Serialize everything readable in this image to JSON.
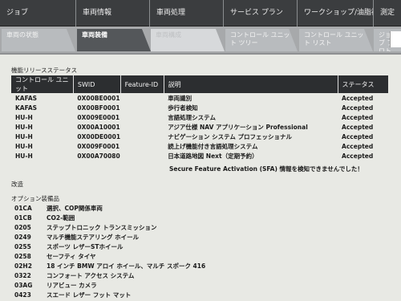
{
  "top_nav": {
    "items": [
      "ジョブ",
      "車両情報",
      "車両処理",
      "サービス プラン",
      "ワークショップ/油脂補",
      "測定"
    ]
  },
  "sub_tabs": [
    {
      "label": "車両の状態"
    },
    {
      "label": "車両装備"
    },
    {
      "label": "車両構成"
    },
    {
      "label": "コントロール ユニット ツリー"
    },
    {
      "label": "コントロール ユニット リスト"
    },
    {
      "label": "ジョブ プロトコル"
    }
  ],
  "release_status": {
    "title": "機能リリースステータス",
    "headers": [
      "コントロール ユニット",
      "SWID",
      "Feature-ID",
      "説明",
      "ステータス"
    ],
    "rows": [
      {
        "unit": "KAFAS",
        "swid": "0X00BE0001",
        "feature": "",
        "desc": "車両識別",
        "status": "Accepted"
      },
      {
        "unit": "KAFAS",
        "swid": "0X00BF0001",
        "feature": "",
        "desc": "歩行者検知",
        "status": "Accepted"
      },
      {
        "unit": "HU-H",
        "swid": "0X009E0001",
        "feature": "",
        "desc": "言語処理システム",
        "status": "Accepted"
      },
      {
        "unit": "HU-H",
        "swid": "0X00A10001",
        "feature": "",
        "desc": "アジア仕様 NAV アプリケーション Professional",
        "status": "Accepted"
      },
      {
        "unit": "HU-H",
        "swid": "0X00DE0001",
        "feature": "",
        "desc": "ナビゲーション システム プロフェッショナル",
        "status": "Accepted"
      },
      {
        "unit": "HU-H",
        "swid": "0X009F0001",
        "feature": "",
        "desc": "読上げ機能付き言語処理システム",
        "status": "Accepted"
      },
      {
        "unit": "HU-H",
        "swid": "0X00A70080",
        "feature": "",
        "desc": "日本道路地図 Next（定期予約）",
        "status": "Accepted"
      }
    ],
    "note": "Secure Feature Activation (SFA) 情報を検知できませんでした！"
  },
  "modification": {
    "title": "改造"
  },
  "options": {
    "title": "オプション装備品",
    "items": [
      {
        "code": "01CA",
        "name": "選択、COP関係車両"
      },
      {
        "code": "01CB",
        "name": "CO2-範囲"
      },
      {
        "code": "0205",
        "name": "ステップトロニック トランスミッション"
      },
      {
        "code": "0249",
        "name": "マルチ機能ステアリング ホイール"
      },
      {
        "code": "0255",
        "name": "スポーツ レザーSTホイール"
      },
      {
        "code": "0258",
        "name": "セーフティ タイヤ"
      },
      {
        "code": "02H2",
        "name": "18 インチ BMW アロイ ホイール、マルチ スポーク 416"
      },
      {
        "code": "0322",
        "name": "コンフォート アクセス システム"
      },
      {
        "code": "03AG",
        "name": "リアビュー カメラ"
      },
      {
        "code": "0423",
        "name": "スエード レザー フット マット"
      }
    ]
  }
}
